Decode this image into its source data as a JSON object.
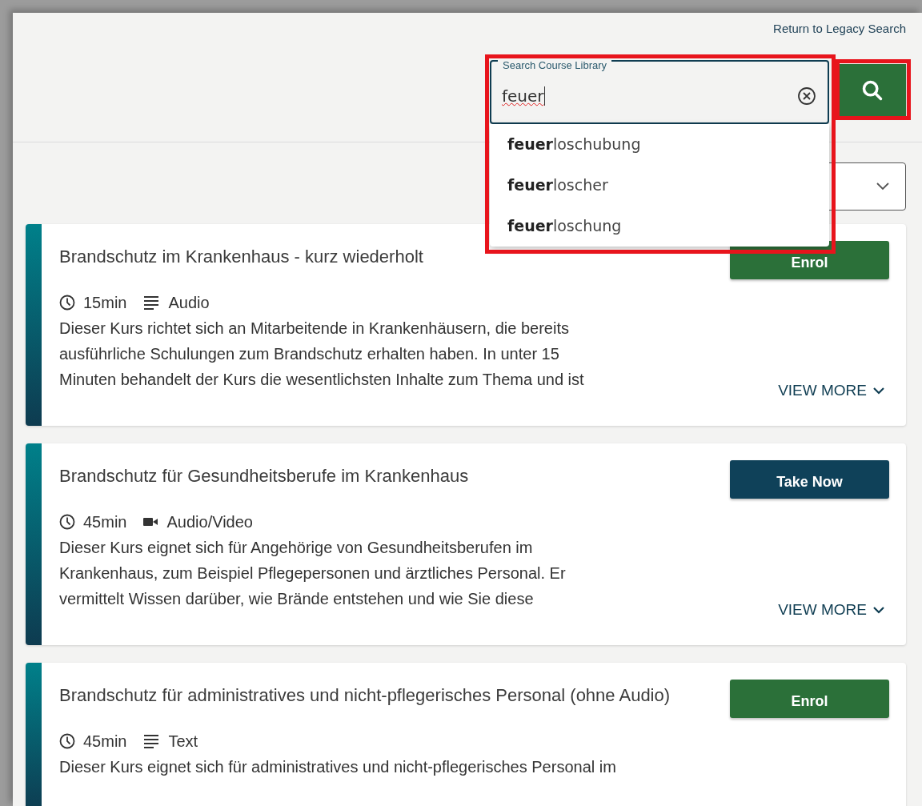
{
  "header": {
    "legacy_link": "Return to Legacy Search"
  },
  "search": {
    "label": "Search Course Library",
    "value": "feuer",
    "suggestions": [
      "**feuer**loschubung",
      "**feuer**loscher",
      "**feuer**loschung"
    ]
  },
  "courses": [
    {
      "title": "Brandschutz im Krankenhaus - kurz wiederholt",
      "duration": "15min",
      "kind": "document",
      "media": "Audio",
      "action": {
        "label": "Enrol",
        "kind": "enrol"
      },
      "description_lines": [
        "Dieser Kurs richtet sich an Mitarbeitende in Krankenhäusern, die bereits",
        "ausführliche Schulungen zum Brandschutz erhalten haben. In unter 15",
        "Minuten behandelt der Kurs die wesentlichsten Inhalte zum Thema und ist"
      ],
      "view_more": "VIEW MORE"
    },
    {
      "title": "Brandschutz für Gesundheitsberufe im Krankenhaus",
      "duration": "45min",
      "kind": "video",
      "media": "Audio/Video",
      "action": {
        "label": "Take Now",
        "kind": "take"
      },
      "description_lines": [
        "Dieser Kurs eignet sich für Angehörige von Gesundheitsberufen im",
        "Krankenhaus, zum Beispiel Pflegepersonen und ärztliches Personal. Er",
        "vermittelt Wissen darüber, wie Brände entstehen und wie Sie diese"
      ],
      "view_more": "VIEW MORE"
    },
    {
      "title": "Brandschutz für administratives und nicht-pflegerisches Personal (ohne Audio)",
      "duration": "45min",
      "kind": "document",
      "media": "Text",
      "action": {
        "label": "Enrol",
        "kind": "enrol"
      },
      "description_lines": [
        "Dieser Kurs eignet sich für administratives und nicht-pflegerisches Personal im"
      ]
    }
  ]
}
